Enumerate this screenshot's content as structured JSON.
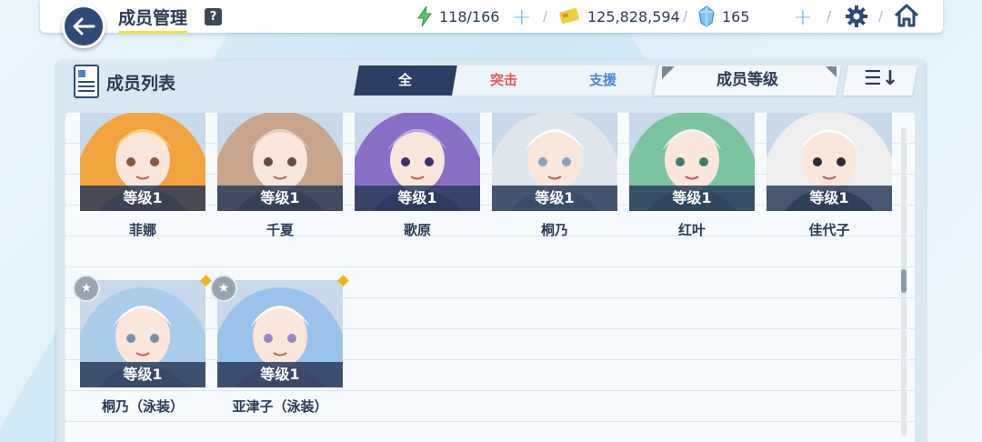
{
  "header": {
    "title": "成员管理",
    "help": "?",
    "stamina": "118/166",
    "credits": "125,828,594",
    "gems": "165"
  },
  "panel": {
    "title": "成员列表",
    "tabs": [
      "全",
      "突击",
      "支援"
    ],
    "sort_label": "成员等级"
  },
  "members": [
    {
      "name": "菲娜",
      "level": "等级1",
      "colors": [
        "#f2a33d",
        "#f7d36b",
        "#8c5a3a"
      ]
    },
    {
      "name": "千夏",
      "level": "等级1",
      "colors": [
        "#c9a38a",
        "#e8cdb8",
        "#6b4a3a"
      ]
    },
    {
      "name": "歌原",
      "level": "等级1",
      "colors": [
        "#8a6fc7",
        "#b9a3e8",
        "#3a2f66"
      ]
    },
    {
      "name": "桐乃",
      "level": "等级1",
      "colors": [
        "#dfe6ee",
        "#ffffff",
        "#8aa1c2"
      ]
    },
    {
      "name": "红叶",
      "level": "等级1",
      "colors": [
        "#7cc4a1",
        "#f0f4f5",
        "#3e7a67"
      ]
    },
    {
      "name": "佳代子",
      "level": "等级1",
      "colors": [
        "#eeeeee",
        "#ffffff",
        "#2d2d33"
      ]
    },
    {
      "name": "桐乃（泳装）",
      "level": "等级1",
      "colors": [
        "#a9cdeb",
        "#ffffff",
        "#7a8fa8"
      ]
    },
    {
      "name": "亚津子（泳装）",
      "level": "等级1",
      "colors": [
        "#9bc2e8",
        "#ffffff",
        "#9a87c4"
      ]
    }
  ]
}
